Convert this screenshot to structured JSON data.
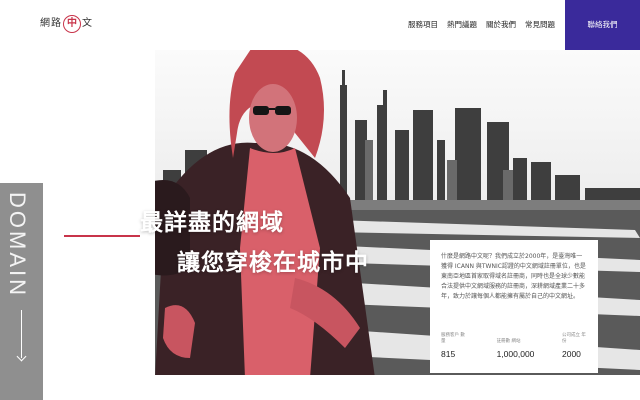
{
  "brand": {
    "before": "網路",
    "mark": "中",
    "after": "文"
  },
  "nav": {
    "items": [
      {
        "label": "服務項目"
      },
      {
        "label": "熱門議題"
      },
      {
        "label": "關於我們"
      },
      {
        "label": "常見問題"
      }
    ],
    "contact_label": "聯絡我們"
  },
  "side": {
    "word": "DOMAIN"
  },
  "hero": {
    "line1": "最詳盡的網域",
    "line2": "讓您穿梭在城市中"
  },
  "card": {
    "text": "什麼是網路中文呢？我們成立於2000年，是臺灣唯一獲得 ICANN 與TWNIC認證的中文網域註冊單位，也是東南亞地區首家取得域名註冊商，同時也是全球少數能合法提供中文網域服務的註冊商，深耕網域產業二十多年，致力於讓每個人都能擁有屬於自己的中文網址。",
    "stats": [
      {
        "label": "服務客戶 數量",
        "value": "815"
      },
      {
        "label": "註冊數 網站",
        "value": "1,000,000"
      },
      {
        "label": "公司成立 年份",
        "value": "2000"
      }
    ]
  },
  "colors": {
    "accent": "#c8344a",
    "contact_bg": "#3a2a9b",
    "strip": "#8f8f8f"
  },
  "icons": {
    "scroll": "arrow-down-icon"
  }
}
